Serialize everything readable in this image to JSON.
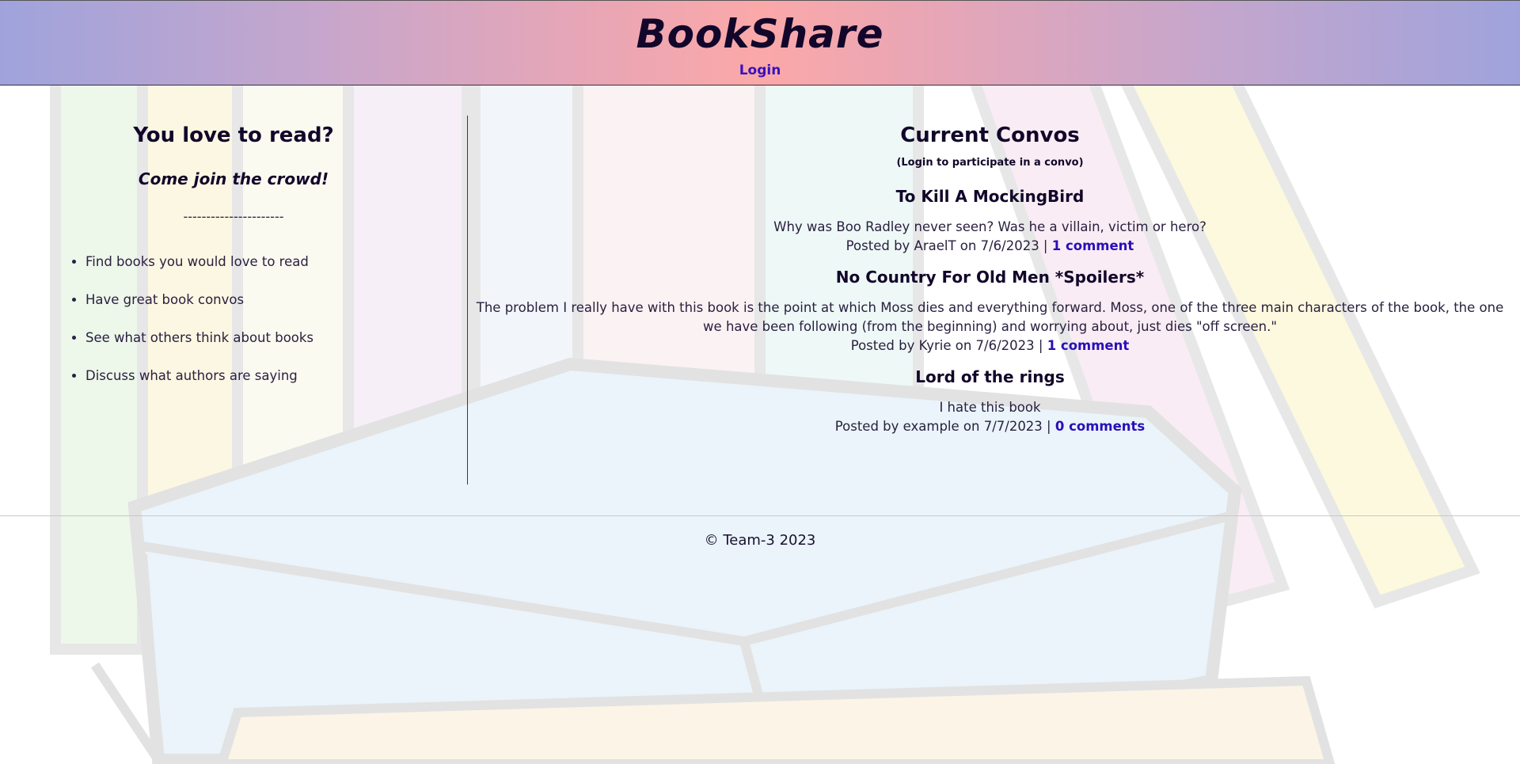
{
  "header": {
    "site_title": "BookShare",
    "login_label": "Login",
    "gradient_colors": [
      "#9fa3dc",
      "#fba8a8"
    ]
  },
  "intro": {
    "heading": "You love to read?",
    "subheading": "Come join the crowd!",
    "divider": "----------------------",
    "features": [
      "Find books you would love to read",
      "Have great book convos",
      "See what others think about books",
      "Discuss what authors are saying"
    ]
  },
  "convos": {
    "heading": "Current Convos",
    "note": "(Login to participate in a convo)",
    "items": [
      {
        "title": "To Kill A MockingBird",
        "body": "Why was Boo Radley never seen? Was he a villain, victim or hero?",
        "meta": "Posted by AraelT on 7/6/2023 | ",
        "comments": "1 comment"
      },
      {
        "title": "No Country For Old Men *Spoilers*",
        "body": "The problem I really have with this book is the point at which Moss dies and everything forward. Moss, one of the three main characters of the book, the one we have been following (from the beginning) and worrying about, just dies \"off screen.\"",
        "meta": "Posted by Kyrie on 7/6/2023 | ",
        "comments": "1 comment"
      },
      {
        "title": "Lord of the rings",
        "body": "I hate this book",
        "meta": "Posted by example on 7/7/2023 | ",
        "comments": "0 comments"
      }
    ]
  },
  "footer": {
    "copyright": "© Team-3 2023"
  },
  "colors": {
    "link": "#2a0fb8",
    "login_link": "#3a10c0",
    "text": "#12062a"
  }
}
